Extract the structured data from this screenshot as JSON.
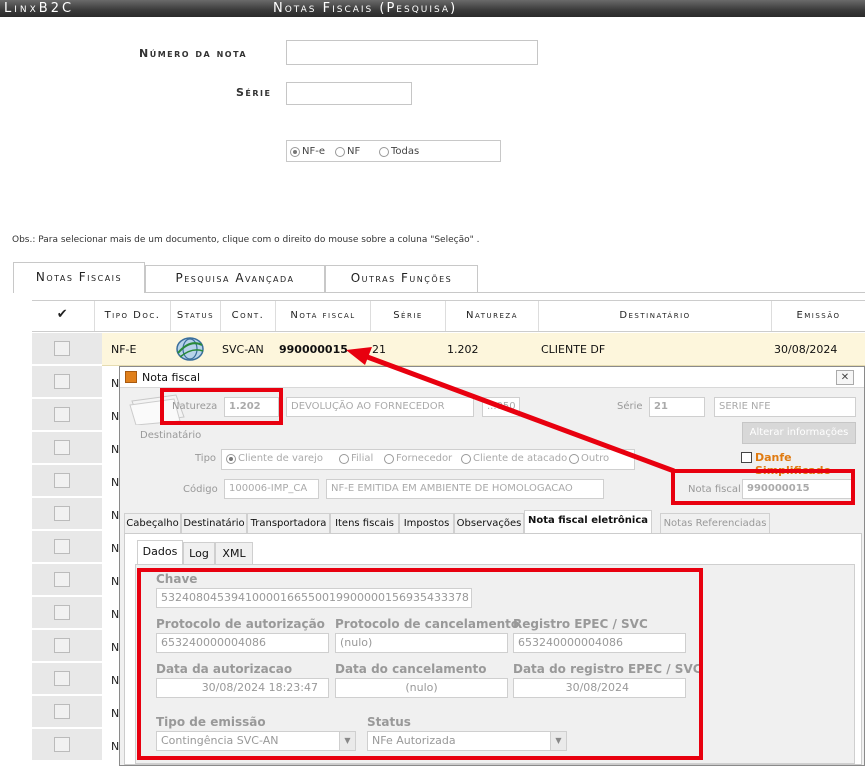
{
  "header": {
    "brand": "LinxB2C",
    "title": "Notas Fiscais (Pesquisa)"
  },
  "search": {
    "numero_label": "Número da nota",
    "numero_value": "",
    "serie_label": "Série",
    "serie_value": "",
    "radio_options": [
      {
        "label": "NF-e",
        "selected": true
      },
      {
        "label": "NF",
        "selected": false
      },
      {
        "label": "Todas",
        "selected": false
      }
    ]
  },
  "obs": "Obs.: Para selecionar mais de um documento, clique com o direito do mouse sobre a coluna \"Seleção\" .",
  "main_tabs": [
    "Notas Fiscais",
    "Pesquisa Avançada",
    "Outras Funções"
  ],
  "grid": {
    "select_header": "✔",
    "columns": [
      "Tipo Doc.",
      "Status",
      "Cont.",
      "Nota fiscal",
      "Série",
      "Natureza",
      "Destinatário",
      "Emissão"
    ],
    "first_row": {
      "tipo": "NF-E",
      "cont": "SVC-AN",
      "nota": "990000015",
      "serie": "21",
      "natureza": "1.202",
      "destinatario": "CLIENTE DF",
      "emissao": "30/08/2024"
    },
    "row_prefix": "N"
  },
  "dialog": {
    "title": "Nota fiscal",
    "close": "✕",
    "natureza_label": "Natureza",
    "natureza_value": "1.202",
    "natureza_desc": "DEVOLUÇÃO AO FORNECEDOR",
    "natureza_extra": "...050",
    "serie_label": "Série",
    "serie_value": "21",
    "serie_desc": "SERIE NFE",
    "alterar_btn": "Alterar informações",
    "destinatario_label": "Destinatário",
    "tipo_label": "Tipo",
    "tipo_options": [
      "Cliente de varejo",
      "Filial",
      "Fornecedor",
      "Cliente de atacado",
      "Outro"
    ],
    "danfe_label": "Danfe Simplificado",
    "codigo_label": "Código",
    "codigo_value": "100006-IMP_CA",
    "codigo_desc": "NF-E EMITIDA EM AMBIENTE DE HOMOLOGACAO",
    "nota_fiscal_label": "Nota fiscal",
    "nota_fiscal_value": "990000015",
    "tabs": [
      "Cabeçalho",
      "Destinatário",
      "Transportadora",
      "Itens fiscais",
      "Impostos",
      "Observações",
      "Nota fiscal eletrônica",
      "Notas Referenciadas"
    ],
    "subtabs": [
      "Dados",
      "Log",
      "XML"
    ],
    "dados": {
      "chave_label": "Chave",
      "chave_value": "53240804539410000166550019900000156935433378",
      "protocolo_aut_label": "Protocolo de autorização",
      "protocolo_aut_value": "653240000004086",
      "protocolo_canc_label": "Protocolo de cancelamento",
      "protocolo_canc_value": "(nulo)",
      "registro_epec_label": "Registro EPEC / SVC",
      "registro_epec_value": "653240000004086",
      "data_aut_label": "Data da autorizacao",
      "data_aut_value": "30/08/2024 18:23:47",
      "data_canc_label": "Data do cancelamento",
      "data_canc_value": "(nulo)",
      "data_epec_label": "Data do registro EPEC / SVC",
      "data_epec_value": "30/08/2024",
      "tipo_emissao_label": "Tipo de emissão",
      "tipo_emissao_value": "Contingência SVC-AN",
      "status_label": "Status",
      "status_value": "NFe Autorizada"
    }
  },
  "colors": {
    "highlight": "#e8000f",
    "danfe": "#e07a10",
    "row_highlight": "#fdf6dc"
  }
}
